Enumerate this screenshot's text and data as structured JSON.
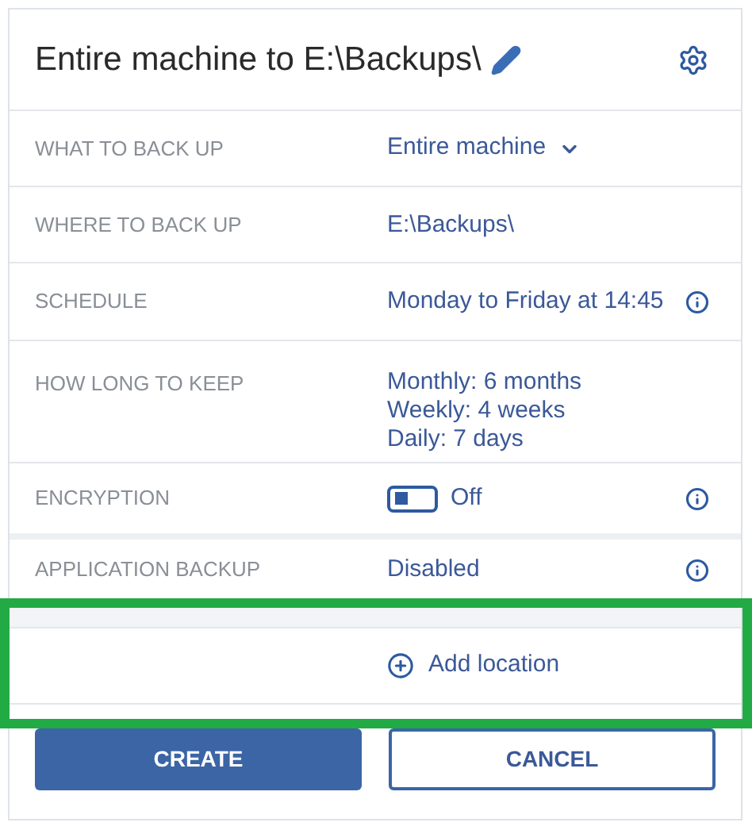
{
  "title": "Entire machine to E:\\Backups\\",
  "rows": [
    {
      "label": "WHAT TO BACK UP",
      "kind": "dropdown",
      "values": [
        "Entire machine"
      ],
      "info": false
    },
    {
      "label": "WHERE TO BACK UP",
      "kind": "text",
      "values": [
        "E:\\Backups\\"
      ],
      "info": false
    },
    {
      "label": "SCHEDULE",
      "kind": "text",
      "values": [
        "Monday to Friday at 14:45"
      ],
      "info": true
    },
    {
      "label": "HOW LONG TO KEEP",
      "kind": "text",
      "values": [
        "Monthly: 6 months",
        "Weekly: 4 weeks",
        "Daily: 7 days"
      ],
      "info": false
    },
    {
      "label": "ENCRYPTION",
      "kind": "toggle",
      "on": false,
      "values": [
        "Off"
      ],
      "info": true
    },
    {
      "label": "APPLICATION BACKUP",
      "kind": "text",
      "values": [
        "Disabled"
      ],
      "info": true
    }
  ],
  "add_location": {
    "label": "Add location",
    "highlighted": true
  },
  "buttons": [
    {
      "label": "CREATE",
      "kind": "primary"
    },
    {
      "label": "CANCEL",
      "kind": "secondary"
    }
  ]
}
